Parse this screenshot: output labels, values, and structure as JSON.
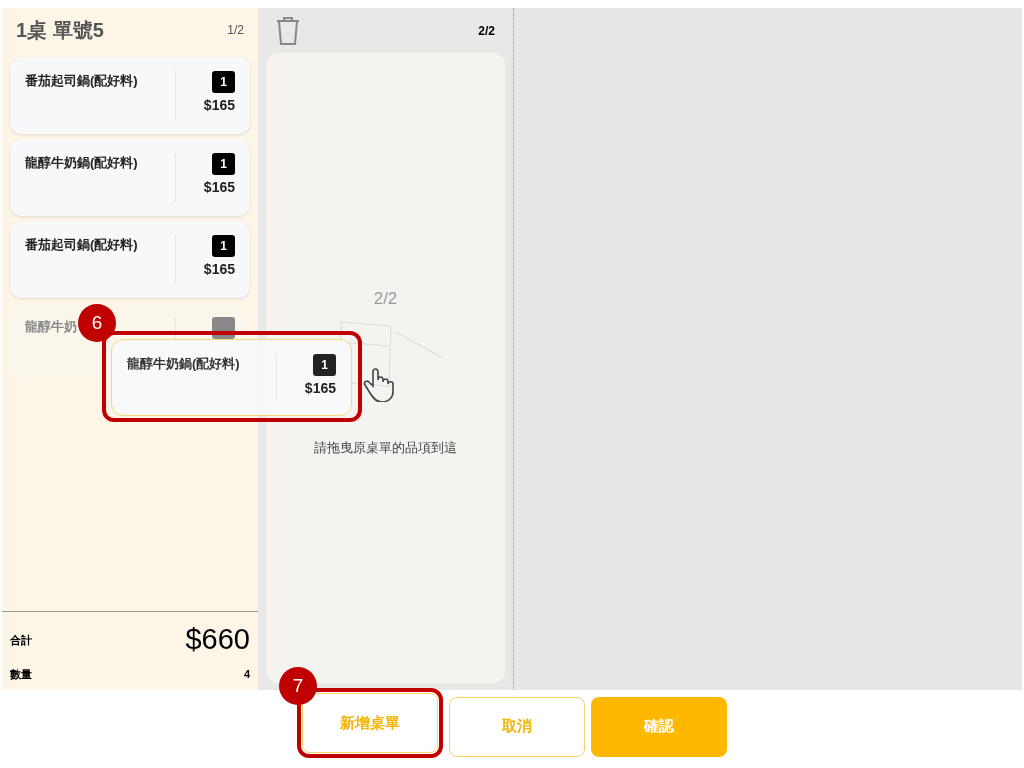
{
  "order": {
    "title": "1桌 單號5",
    "page": "1/2",
    "items": [
      {
        "name": "番茄起司鍋(配好料)",
        "qty": "1",
        "price": "$165",
        "dragging": false
      },
      {
        "name": "龍醇牛奶鍋(配好料)",
        "qty": "1",
        "price": "$165",
        "dragging": false
      },
      {
        "name": "番茄起司鍋(配好料)",
        "qty": "1",
        "price": "$165",
        "dragging": false
      },
      {
        "name": "龍醇牛奶",
        "dragging": true
      }
    ],
    "total_label": "合計",
    "total": "$660",
    "count_label": "數量",
    "count": "4"
  },
  "new_order": {
    "page": "2/2",
    "empty_page": "2/2",
    "hint": "請拖曳原桌單的品項到這"
  },
  "drag_preview": {
    "name": "龍醇牛奶鍋(配好料)",
    "qty": "1",
    "price": "$165"
  },
  "buttons": [
    {
      "label": "新增桌單",
      "kind": "outline",
      "highlighted": true
    },
    {
      "label": "取消",
      "kind": "outline",
      "highlighted": false
    },
    {
      "label": "確認",
      "kind": "filled",
      "highlighted": false
    }
  ],
  "callouts": [
    {
      "number": "6"
    },
    {
      "number": "7"
    }
  ]
}
